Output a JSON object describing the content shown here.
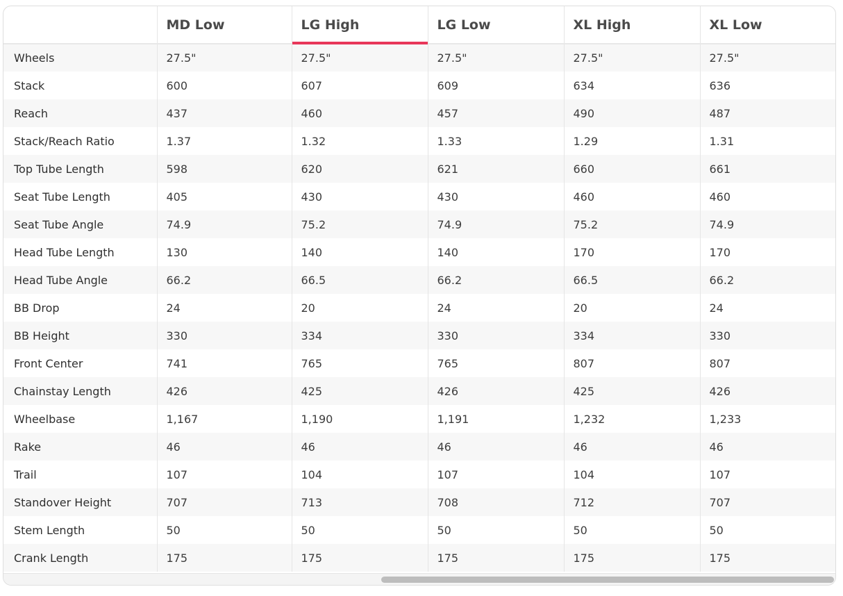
{
  "table": {
    "columns": [
      "",
      "MD Low",
      "LG High",
      "LG Low",
      "XL High",
      "XL Low"
    ],
    "active_column": "LG High",
    "accent_color": "#e8375a",
    "rows": [
      {
        "label": "Wheels",
        "values": [
          "27.5\"",
          "27.5\"",
          "27.5\"",
          "27.5\"",
          "27.5\""
        ]
      },
      {
        "label": "Stack",
        "values": [
          "600",
          "607",
          "609",
          "634",
          "636"
        ]
      },
      {
        "label": "Reach",
        "values": [
          "437",
          "460",
          "457",
          "490",
          "487"
        ]
      },
      {
        "label": "Stack/Reach Ratio",
        "values": [
          "1.37",
          "1.32",
          "1.33",
          "1.29",
          "1.31"
        ]
      },
      {
        "label": "Top Tube Length",
        "values": [
          "598",
          "620",
          "621",
          "660",
          "661"
        ]
      },
      {
        "label": "Seat Tube Length",
        "values": [
          "405",
          "430",
          "430",
          "460",
          "460"
        ]
      },
      {
        "label": "Seat Tube Angle",
        "values": [
          "74.9",
          "75.2",
          "74.9",
          "75.2",
          "74.9"
        ]
      },
      {
        "label": "Head Tube Length",
        "values": [
          "130",
          "140",
          "140",
          "170",
          "170"
        ]
      },
      {
        "label": "Head Tube Angle",
        "values": [
          "66.2",
          "66.5",
          "66.2",
          "66.5",
          "66.2"
        ]
      },
      {
        "label": "BB Drop",
        "values": [
          "24",
          "20",
          "24",
          "20",
          "24"
        ]
      },
      {
        "label": "BB Height",
        "values": [
          "330",
          "334",
          "330",
          "334",
          "330"
        ]
      },
      {
        "label": "Front Center",
        "values": [
          "741",
          "765",
          "765",
          "807",
          "807"
        ]
      },
      {
        "label": "Chainstay Length",
        "values": [
          "426",
          "425",
          "426",
          "425",
          "426"
        ]
      },
      {
        "label": "Wheelbase",
        "values": [
          "1,167",
          "1,190",
          "1,191",
          "1,232",
          "1,233"
        ]
      },
      {
        "label": "Rake",
        "values": [
          "46",
          "46",
          "46",
          "46",
          "46"
        ]
      },
      {
        "label": "Trail",
        "values": [
          "107",
          "104",
          "107",
          "104",
          "107"
        ]
      },
      {
        "label": "Standover Height",
        "values": [
          "707",
          "713",
          "708",
          "712",
          "707"
        ]
      },
      {
        "label": "Stem Length",
        "values": [
          "50",
          "50",
          "50",
          "50",
          "50"
        ]
      },
      {
        "label": "Crank Length",
        "values": [
          "175",
          "175",
          "175",
          "175",
          "175"
        ]
      }
    ]
  }
}
